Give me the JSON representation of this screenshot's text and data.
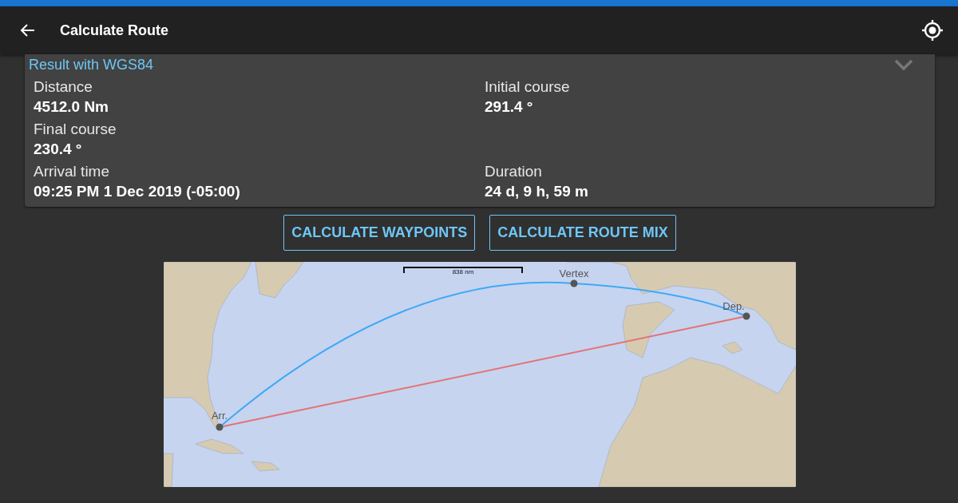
{
  "app_bar": {
    "title": "Calculate Route"
  },
  "result": {
    "title": "Result with WGS84",
    "rows": [
      [
        {
          "label": "Distance",
          "value": "4512.0 Nm"
        },
        {
          "label": "Initial course",
          "value": "291.4 °"
        }
      ],
      [
        {
          "label": "Final course",
          "value": "230.4 °"
        }
      ],
      [
        {
          "label": "Arrival time",
          "value": "09:25 PM 1 Dec 2019 (-05:00)"
        },
        {
          "label": "Duration",
          "value": "24 d, 9 h, 59 m"
        }
      ]
    ]
  },
  "buttons": [
    "CALCULATE WAYPOINTS",
    "CALCULATE ROUTE MIX"
  ],
  "map": {
    "scale": "838 nm",
    "points": [
      {
        "label": "Vertex",
        "kind": "vertex"
      },
      {
        "label": "Dep.",
        "kind": "departure"
      },
      {
        "label": "Arr.",
        "kind": "arrival"
      }
    ]
  }
}
